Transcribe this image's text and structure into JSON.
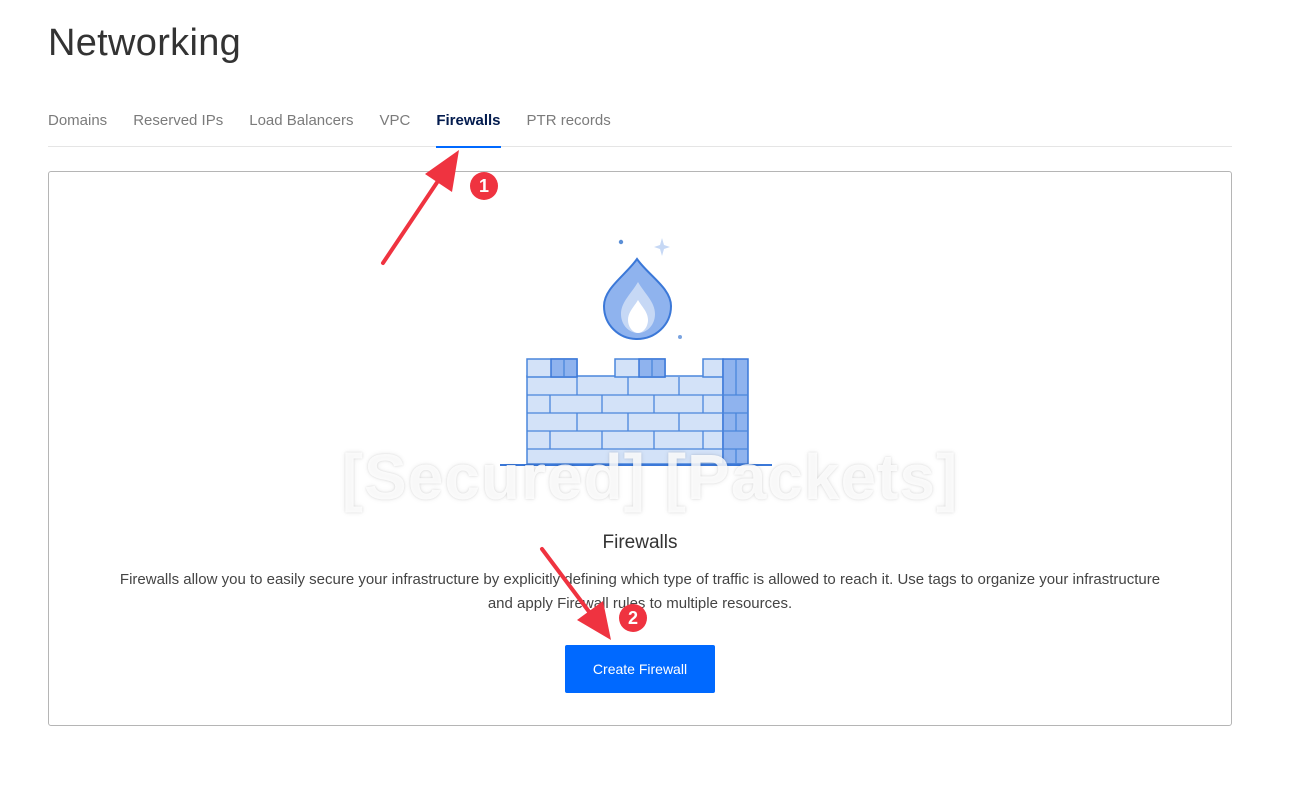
{
  "page": {
    "title": "Networking"
  },
  "tabs": [
    {
      "label": "Domains",
      "active": false
    },
    {
      "label": "Reserved IPs",
      "active": false
    },
    {
      "label": "Load Balancers",
      "active": false
    },
    {
      "label": "VPC",
      "active": false
    },
    {
      "label": "Firewalls",
      "active": true
    },
    {
      "label": "PTR records",
      "active": false
    }
  ],
  "empty_state": {
    "illustration": "firewall-wall-with-flame-icon",
    "watermark": "[Secured] [Packets]",
    "title": "Firewalls",
    "description_line1": "Firewalls allow you to easily secure your infrastructure by explicitly defining which type of traffic is allowed to reach it. Use tags to organize your infrastructure",
    "description_line2": "and apply Firewall rules to multiple resources.",
    "button_label": "Create Firewall"
  },
  "annotations": [
    {
      "number": "1",
      "target": "tab-firewalls"
    },
    {
      "number": "2",
      "target": "create-firewall-button"
    }
  ],
  "colors": {
    "accent": "#0069ff",
    "annotation": "#ef3340",
    "active_tab_text": "#031b4e"
  }
}
